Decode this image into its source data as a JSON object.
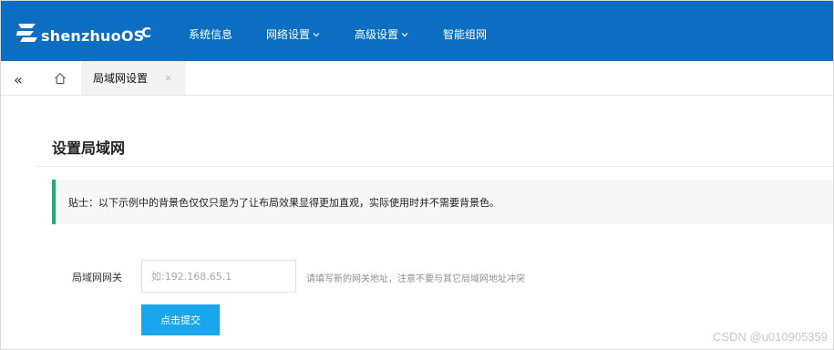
{
  "brand": {
    "name": "shenzhuoOS"
  },
  "nav": {
    "refresh_glyph": "C",
    "items": [
      {
        "label": "系统信息",
        "has_dropdown": false
      },
      {
        "label": "网络设置",
        "has_dropdown": true
      },
      {
        "label": "高级设置",
        "has_dropdown": true
      },
      {
        "label": "智能组网",
        "has_dropdown": false
      }
    ]
  },
  "tabs": {
    "collapse_glyph": "«",
    "active_tab": {
      "label": "局域网设置",
      "close_glyph": "×"
    }
  },
  "page": {
    "title": "设置局域网",
    "tip": "贴士：以下示例中的背景色仅仅只是为了让布局效果显得更加直观，实际使用时并不需要背景色。"
  },
  "form": {
    "gateway_label": "局域网网关",
    "gateway_value": "",
    "gateway_placeholder": "如:192.168.65.1",
    "gateway_hint": "请填写新的网关地址，注意不要与其它局域网地址冲突",
    "submit_label": "点击提交"
  },
  "watermark": "CSDN @u010905359",
  "colors": {
    "header_bg": "#0b6ec2",
    "tip_accent": "#19b07c",
    "button_bg": "#1aa5ec"
  }
}
